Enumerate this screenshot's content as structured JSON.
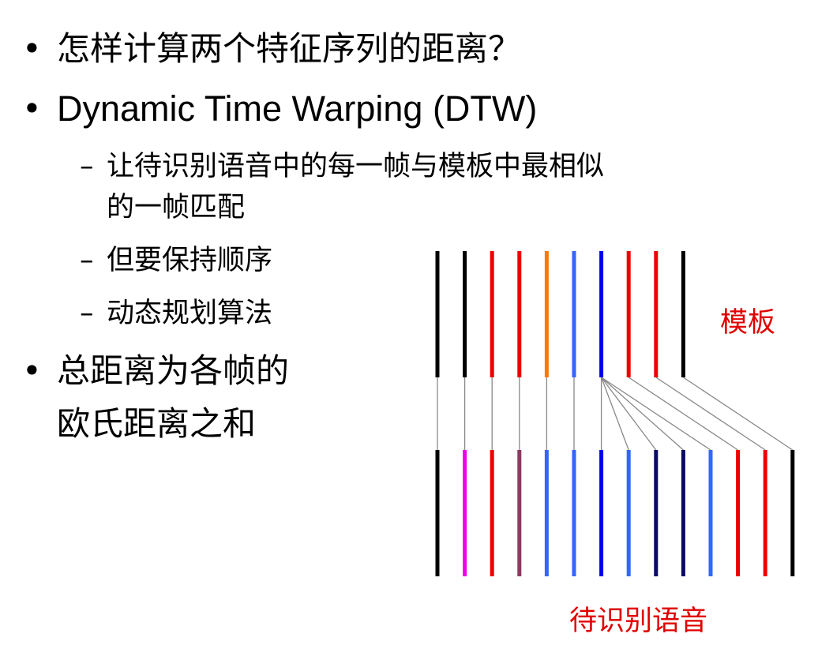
{
  "bullets": {
    "b1": "怎样计算两个特征序列的距离？",
    "b2": "Dynamic Time Warping (DTW)",
    "sub1_line1": "让待识别语音中的每一帧与模板中最相似",
    "sub1_line2": "的一帧匹配",
    "sub2": "但要保持顺序",
    "sub3": "动态规划算法",
    "b3_line1": "总距离为各帧的",
    "b3_line2": "欧氏距离之和"
  },
  "labels": {
    "template": "模板",
    "test": "待识别语音"
  },
  "colors": {
    "black": "#000000",
    "red": "#ee0000",
    "orange": "#ff7700",
    "blue": "#3366ff",
    "deep_blue": "#0000ee",
    "magenta": "#ee00ee",
    "purple": "#8b3a62",
    "navy": "#0a0a66",
    "link": "#888888"
  },
  "diagram": {
    "template_frames": [
      "black",
      "black",
      "red",
      "red",
      "orange",
      "blue",
      "deep_blue",
      "red",
      "red",
      "black"
    ],
    "test_frames": [
      "black",
      "magenta",
      "red",
      "purple",
      "blue",
      "blue",
      "deep_blue",
      "blue",
      "navy",
      "navy",
      "blue",
      "red",
      "red",
      "black"
    ],
    "alignment": [
      [
        0,
        0
      ],
      [
        1,
        1
      ],
      [
        2,
        2
      ],
      [
        3,
        3
      ],
      [
        4,
        4
      ],
      [
        5,
        5
      ],
      [
        6,
        6
      ],
      [
        6,
        7
      ],
      [
        6,
        8
      ],
      [
        6,
        9
      ],
      [
        6,
        10
      ],
      [
        7,
        11
      ],
      [
        8,
        12
      ],
      [
        9,
        13
      ]
    ]
  }
}
